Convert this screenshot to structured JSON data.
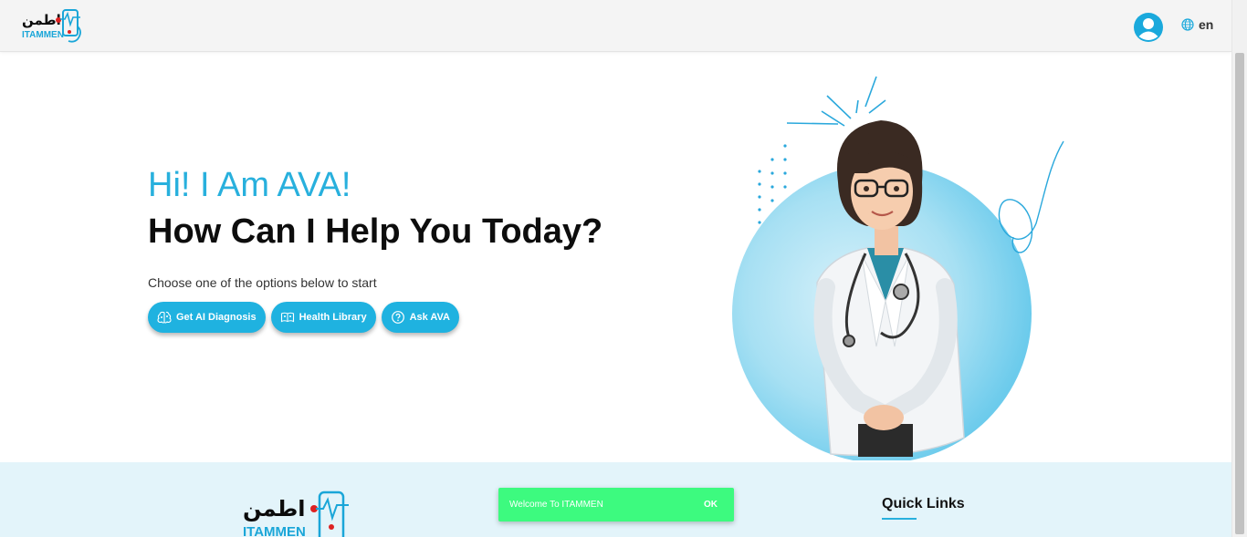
{
  "header": {
    "logo_text_en": "ITAMMEN",
    "logo_text_ar": "اطمن",
    "lang_label": "en",
    "avatar_icon": "user-circle-icon",
    "lang_icon": "globe-icon"
  },
  "hero": {
    "title": "Hi! I Am AVA!",
    "subtitle": "How Can I Help You Today?",
    "prompt": "Choose one of the options below to start",
    "buttons": [
      {
        "label": "Get AI Diagnosis",
        "icon": "ai-brain-icon"
      },
      {
        "label": "Health Library",
        "icon": "health-book-icon"
      },
      {
        "label": "Ask AVA",
        "icon": "question-circle-icon"
      }
    ]
  },
  "footer": {
    "logo_text_en": "ITAMMEN",
    "logo_text_ar": "اطمن",
    "quick_links_title": "Quick Links"
  },
  "toast": {
    "message": "Welcome To ITAMMEN",
    "ok_label": "OK"
  },
  "colors": {
    "accent": "#28b0dd",
    "button": "#1fb2e0",
    "toast": "#3dfa7f",
    "footer_bg": "#e3f4fa"
  }
}
